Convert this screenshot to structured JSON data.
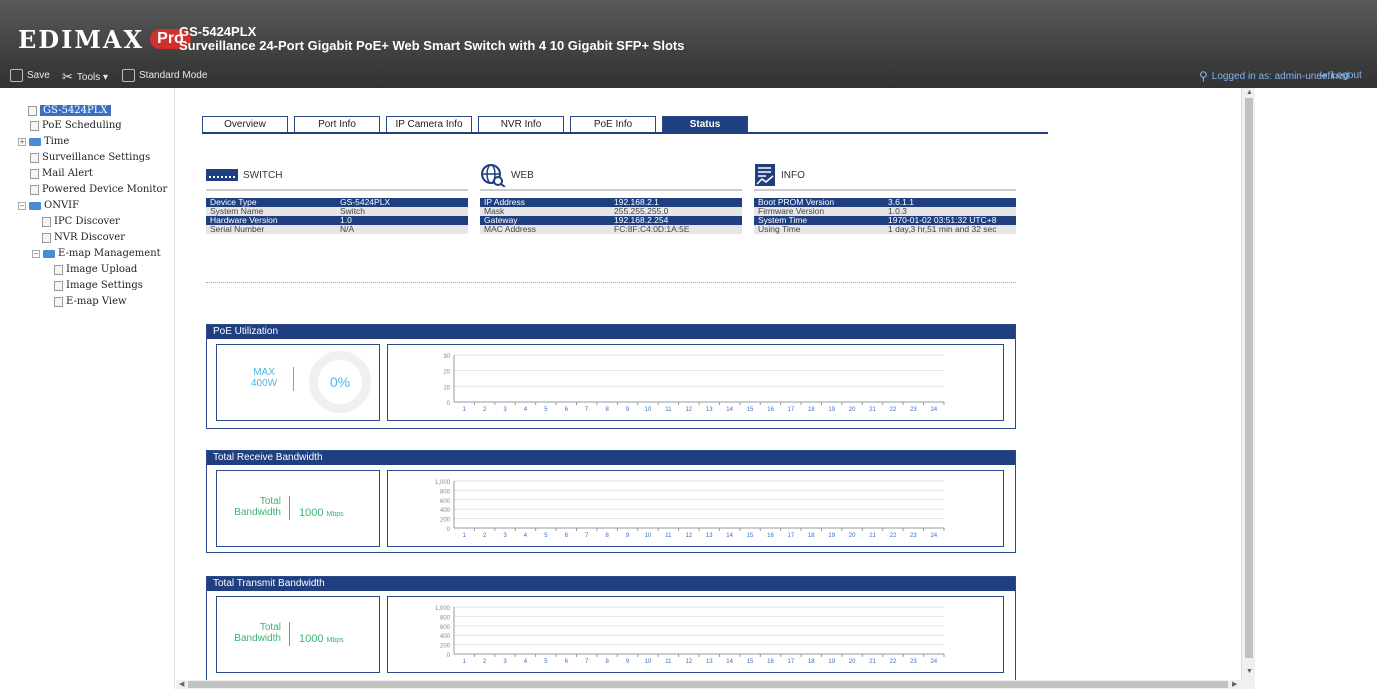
{
  "header": {
    "logo_text": "EDIMAX",
    "logo_badge": "Pro",
    "model": "GS-5424PLX",
    "description": "Surveillance 24-Port Gigabit PoE+ Web Smart Switch with 4 10 Gigabit SFP+ Slots"
  },
  "toolbar": {
    "save": "Save",
    "tools": "Tools ▾",
    "standard_mode": "Standard Mode",
    "logged_in": "Logged in as: admin-undefined",
    "logout": "Logout"
  },
  "tree": [
    {
      "label": "GS-5424PLX",
      "level": 0,
      "type": "doc",
      "selected": true
    },
    {
      "label": "PoE Scheduling",
      "level": 1,
      "type": "doc"
    },
    {
      "label": "Time",
      "level": 1,
      "type": "folder",
      "expander": "+"
    },
    {
      "label": "Surveillance Settings",
      "level": 1,
      "type": "doc"
    },
    {
      "label": "Mail Alert",
      "level": 1,
      "type": "doc"
    },
    {
      "label": "Powered Device Monitor",
      "level": 1,
      "type": "doc"
    },
    {
      "label": "ONVIF",
      "level": 1,
      "type": "folder",
      "expander": "−"
    },
    {
      "label": "IPC Discover",
      "level": 2,
      "type": "doc"
    },
    {
      "label": "NVR Discover",
      "level": 2,
      "type": "doc"
    },
    {
      "label": "E-map Management",
      "level": 2,
      "type": "folder",
      "expander": "−"
    },
    {
      "label": "Image Upload",
      "level": 3,
      "type": "doc"
    },
    {
      "label": "Image Settings",
      "level": 3,
      "type": "doc"
    },
    {
      "label": "E-map View",
      "level": 3,
      "type": "doc"
    }
  ],
  "tabs": [
    "Overview",
    "Port Info",
    "IP Camera Info",
    "NVR Info",
    "PoE Info",
    "Status"
  ],
  "active_tab": "Status",
  "switch": {
    "title": "SWITCH",
    "rows": [
      {
        "k": "Device Type",
        "v": "GS-5424PLX"
      },
      {
        "k": "System Name",
        "v": "Switch"
      },
      {
        "k": "Hardware Version",
        "v": "1.0"
      },
      {
        "k": "Serial Number",
        "v": "N/A"
      }
    ]
  },
  "web": {
    "title": "WEB",
    "rows": [
      {
        "k": "IP Address",
        "v": "192.168.2.1"
      },
      {
        "k": "Mask",
        "v": "255.255.255.0"
      },
      {
        "k": "Gateway",
        "v": "192.168.2.254"
      },
      {
        "k": "MAC Address",
        "v": "FC:8F:C4:0D:1A:5E"
      }
    ]
  },
  "info": {
    "title": "INFO",
    "rows": [
      {
        "k": "Boot PROM Version",
        "v": "3.6.1.1"
      },
      {
        "k": "Firmware Version",
        "v": "1.0.3"
      },
      {
        "k": "System Time",
        "v": "1970-01-02 03:51:32 UTC+8"
      },
      {
        "k": "Using Time",
        "v": "1 day,3 hr,51 min and 32 sec"
      }
    ]
  },
  "poe": {
    "title": "PoE Utilization",
    "max_label": "MAX",
    "max_value": "400W",
    "percent": "0%"
  },
  "receive": {
    "title": "Total Receive Bandwidth",
    "label1": "Total",
    "label2": "Bandwidth",
    "value": "1000",
    "unit": "Mbps"
  },
  "transmit": {
    "title": "Total Transmit Bandwidth",
    "label1": "Total",
    "label2": "Bandwidth",
    "value": "1000",
    "unit": "Mbps"
  },
  "chart_data": [
    {
      "type": "bar",
      "categories": [
        "1",
        "2",
        "3",
        "4",
        "5",
        "6",
        "7",
        "8",
        "9",
        "10",
        "11",
        "12",
        "13",
        "14",
        "15",
        "16",
        "17",
        "18",
        "19",
        "20",
        "21",
        "22",
        "23",
        "24"
      ],
      "values": [
        0,
        0,
        0,
        0,
        0,
        0,
        0,
        0,
        0,
        0,
        0,
        0,
        0,
        0,
        0,
        0,
        0,
        0,
        0,
        0,
        0,
        0,
        0,
        0
      ],
      "yticks": [
        "30",
        "20",
        "10",
        "0"
      ],
      "ylim": [
        0,
        30
      ]
    },
    {
      "type": "bar",
      "categories": [
        "1",
        "2",
        "3",
        "4",
        "5",
        "6",
        "7",
        "8",
        "9",
        "10",
        "11",
        "12",
        "13",
        "14",
        "15",
        "16",
        "17",
        "18",
        "19",
        "20",
        "21",
        "22",
        "23",
        "24"
      ],
      "values": [
        0,
        0,
        0,
        0,
        0,
        0,
        0,
        0,
        0,
        0,
        0,
        0,
        0,
        0,
        0,
        0,
        0,
        0,
        0,
        0,
        0,
        0,
        0,
        0
      ],
      "yticks": [
        "1,000",
        "800",
        "600",
        "400",
        "200",
        "0"
      ],
      "ylim": [
        0,
        1000
      ]
    },
    {
      "type": "bar",
      "categories": [
        "1",
        "2",
        "3",
        "4",
        "5",
        "6",
        "7",
        "8",
        "9",
        "10",
        "11",
        "12",
        "13",
        "14",
        "15",
        "16",
        "17",
        "18",
        "19",
        "20",
        "21",
        "22",
        "23",
        "24"
      ],
      "values": [
        0,
        0,
        0,
        0,
        0,
        0,
        0,
        0,
        0,
        0,
        0,
        0,
        0,
        0,
        0,
        0,
        0,
        0,
        0,
        0,
        0,
        0,
        0,
        0
      ],
      "yticks": [
        "1,000",
        "800",
        "600",
        "400",
        "200",
        "0"
      ],
      "ylim": [
        0,
        1000
      ]
    }
  ]
}
